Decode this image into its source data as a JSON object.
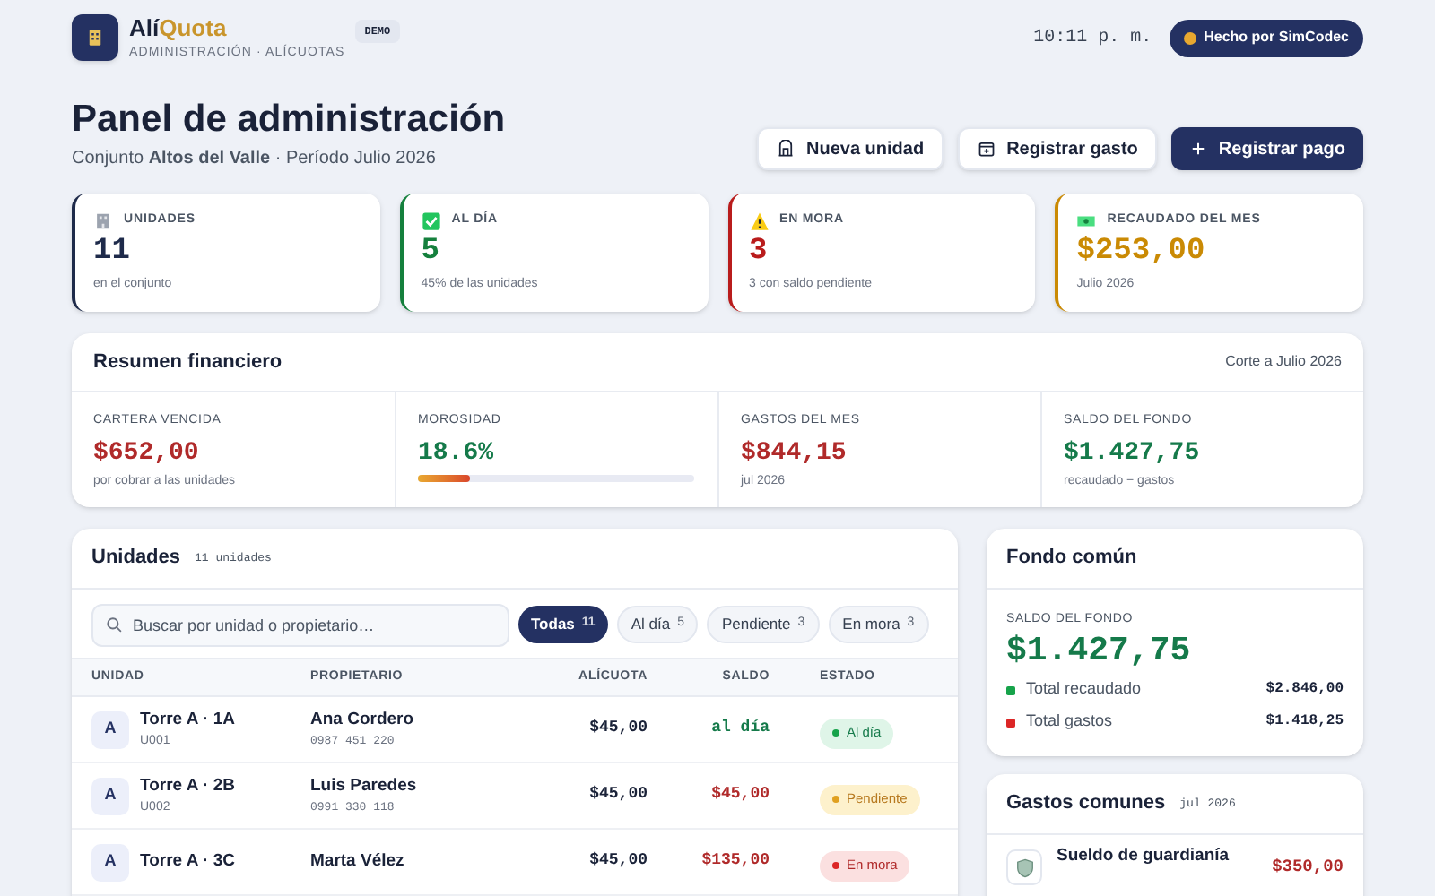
{
  "brand": {
    "name_part_1": "Alí",
    "name_part_2": "Quota",
    "subtitle": "ADMINISTRACIÓN · ALÍCUOTAS",
    "badge": "DEMO"
  },
  "header": {
    "time": "10:11 p. m.",
    "credit": "Hecho por SimCodec"
  },
  "page": {
    "title": "Panel de administración",
    "subtitle": "Conjunto **Altos del Valle** · Período Julio 2026"
  },
  "actions": [
    {
      "label": "Nueva unidad",
      "kind": "secondary"
    },
    {
      "label": "Registrar gasto",
      "kind": "secondary"
    },
    {
      "label": "Registrar pago",
      "kind": "primary"
    }
  ],
  "stats": [
    {
      "label": "UNIDADES",
      "value": "11",
      "note": "en el conjunto",
      "color": "#1e2a4a"
    },
    {
      "label": "AL DÍA",
      "value": "5",
      "note": "45% de las unidades",
      "color": "#15803d"
    },
    {
      "label": "EN MORA",
      "value": "3",
      "note": "3 con saldo pendiente",
      "color": "#b91c1c"
    },
    {
      "label": "RECAUDADO DEL MES",
      "value": "$253,00",
      "note": "Julio 2026",
      "color": "#ca8a04"
    }
  ],
  "summary": {
    "title": "Resumen financiero",
    "date": "Corte a Julio 2026",
    "metrics": [
      {
        "label": "CARTERA VENCIDA",
        "value": "$652,00",
        "note": "por cobrar a las unidades",
        "kind": "negative"
      },
      {
        "label": "MOROSIDAD",
        "value": "18.6%",
        "level": 0.186,
        "kind": "meter"
      },
      {
        "label": "GASTOS DEL MES",
        "value": "$844,15",
        "note": "jul 2026",
        "kind": "negative"
      },
      {
        "label": "SALDO DEL FONDO",
        "value": "$1.427,75",
        "note": "recaudado − gastos",
        "kind": "positive"
      }
    ]
  },
  "units": {
    "title": "Unidades",
    "count": "11 unidades",
    "search": {
      "placeholder": "Buscar por unidad o propietario…"
    },
    "filters": [
      {
        "label": "Todas",
        "count": "11",
        "selected": true
      },
      {
        "label": "Al día",
        "count": "5",
        "selected": false
      },
      {
        "label": "Pendiente",
        "count": "3",
        "selected": false
      },
      {
        "label": "En mora",
        "count": "3",
        "selected": false
      }
    ],
    "columns": [
      "UNIDAD",
      "PROPIETARIO",
      "ALÍCUOTA",
      "SALDO",
      "ESTADO"
    ],
    "rows": [
      {
        "tower": "A",
        "unit": "Torre A · 1A",
        "code": "U001",
        "owner": "Ana Cordero",
        "phone": "0987 451 220",
        "fee": "$45,00",
        "balance": "al día",
        "status": "Al día",
        "kind": "ok"
      },
      {
        "tower": "A",
        "unit": "Torre A · 2B",
        "code": "U002",
        "owner": "Luis Paredes",
        "phone": "0991 330 118",
        "fee": "$45,00",
        "balance": "$45,00",
        "status": "Pendiente",
        "kind": "pending"
      },
      {
        "tower": "A",
        "unit": "Torre A · 3C",
        "owner": "Marta Vélez",
        "fee": "$45,00",
        "balance": "$135,00",
        "status": "En mora",
        "kind": "late"
      }
    ]
  },
  "fund": {
    "title": "Fondo común",
    "label": "SALDO DEL FONDO",
    "value": "$1.427,75",
    "lines": [
      {
        "label": "Total recaudado",
        "value": "$2.846,00",
        "color": "#16a34a"
      },
      {
        "label": "Total gastos",
        "value": "$1.418,25",
        "color": "#dc2626"
      }
    ]
  },
  "expenses": {
    "title": "Gastos comunes",
    "period": "jul 2026",
    "items": [
      {
        "name": "Sueldo de guardianía",
        "amount": "$350,00"
      }
    ]
  }
}
